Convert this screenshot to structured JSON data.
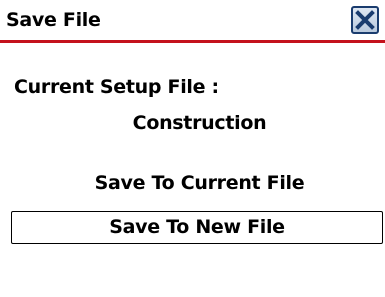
{
  "dialog": {
    "title": "Save File",
    "close_icon": "close-x-icon",
    "accent_color": "#c4121c"
  },
  "content": {
    "current_label": "Current Setup File :",
    "current_file": "Construction"
  },
  "actions": {
    "save_current_label": "Save To Current File",
    "save_new_label": "Save To New File"
  }
}
